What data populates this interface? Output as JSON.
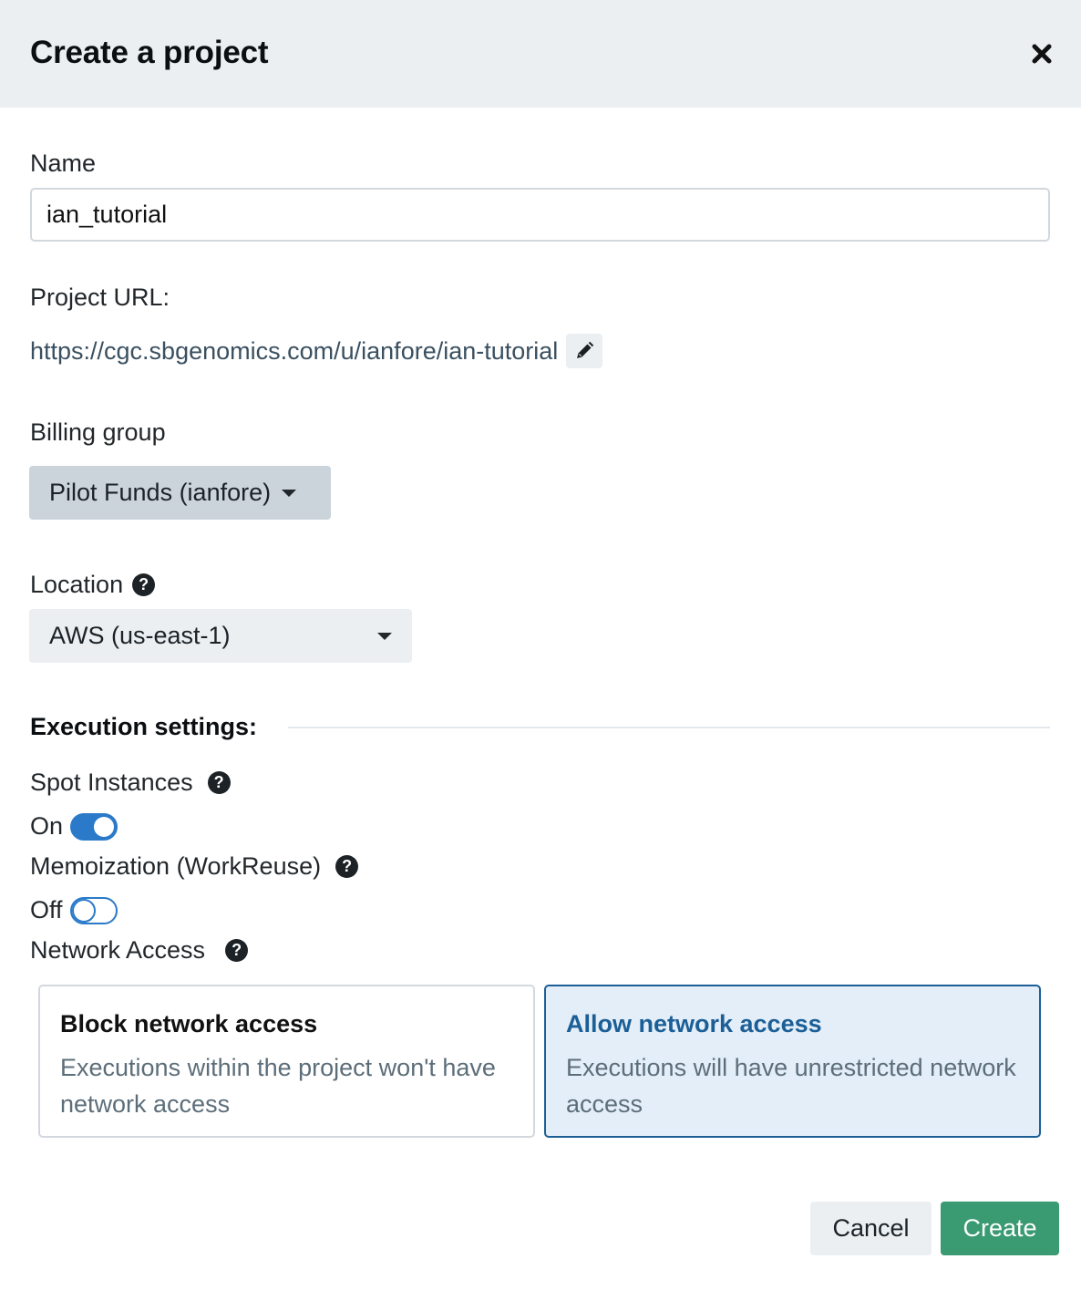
{
  "header": {
    "title": "Create a project",
    "close_icon": "close-icon"
  },
  "name": {
    "label": "Name",
    "value": "ian_tutorial"
  },
  "project_url": {
    "label": "Project URL:",
    "url": "https://cgc.sbgenomics.com/u/ianfore/ian-tutorial",
    "edit_icon": "pencil-icon"
  },
  "billing": {
    "label": "Billing group",
    "selected": "Pilot Funds (ianfore)"
  },
  "location": {
    "label": "Location",
    "selected": "AWS (us-east-1)",
    "help_icon": "?"
  },
  "execution": {
    "title": "Execution settings:",
    "spot": {
      "label": "Spot Instances",
      "state_label": "On",
      "on": true
    },
    "memo": {
      "label": "Memoization (WorkReuse)",
      "state_label": "Off",
      "on": false
    },
    "network": {
      "label": "Network Access",
      "options": [
        {
          "title": "Block network access",
          "desc": "Executions within the project won't have network access",
          "selected": false
        },
        {
          "title": "Allow network access",
          "desc": "Executions will have unrestricted network access",
          "selected": true
        }
      ]
    }
  },
  "footer": {
    "cancel": "Cancel",
    "create": "Create"
  },
  "colors": {
    "accent": "#2a7ac9",
    "create_button": "#3a9a72",
    "selected_card_border": "#1c5f97",
    "header_bg": "#ebeff2"
  }
}
